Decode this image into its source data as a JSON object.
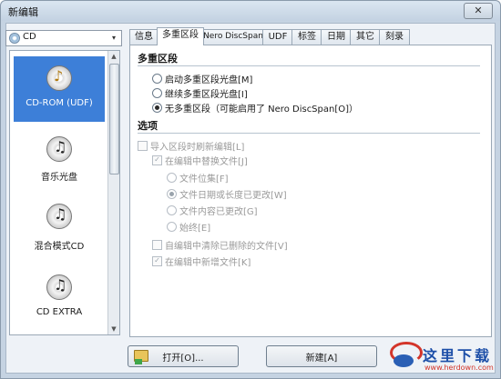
{
  "window": {
    "title": "新编辑",
    "close_glyph": "✕"
  },
  "disc_type_combo": {
    "value": "CD",
    "icon": "disc-icon",
    "arrow": "▾"
  },
  "sidebar": {
    "scroll_up": "▲",
    "scroll_down": "▼",
    "selected_arrow": "▸",
    "items": [
      {
        "label": "CD-ROM (UDF)",
        "icon": "cd-rom-icon",
        "glyph": "♪"
      },
      {
        "label": "音乐光盘",
        "icon": "music-disc-icon",
        "glyph": "♫"
      },
      {
        "label": "混合模式CD",
        "icon": "mixed-mode-cd-icon",
        "glyph": "♫"
      },
      {
        "label": "CD EXTRA",
        "icon": "cd-extra-icon",
        "glyph": "♫"
      }
    ]
  },
  "tabs": [
    {
      "label": "信息"
    },
    {
      "label": "多重区段"
    },
    {
      "label": "Nero DiscSpan"
    },
    {
      "label": "UDF"
    },
    {
      "label": "标签"
    },
    {
      "label": "日期"
    },
    {
      "label": "其它"
    },
    {
      "label": "刻录"
    }
  ],
  "active_tab": "多重区段",
  "multisession": {
    "heading": "多重区段",
    "options": [
      {
        "label": "启动多重区段光盘[M]",
        "selected": false
      },
      {
        "label": "继续多重区段光盘[I]",
        "selected": false
      },
      {
        "label": "无多重区段（可能启用了 Nero DiscSpan[O]）",
        "selected": true
      }
    ]
  },
  "options_section": {
    "heading": "选项",
    "import_refresh": "导入区段时刷新编辑[L]",
    "replace_in_edit": "在编辑中替换文件[J]",
    "replace_modes": [
      {
        "label": "文件位集[F]",
        "selected": false
      },
      {
        "label": "文件日期或长度已更改[W]",
        "selected": true
      },
      {
        "label": "文件内容已更改[G]",
        "selected": false
      },
      {
        "label": "始终[E]",
        "selected": false
      }
    ],
    "remove_deleted": "自编辑中清除已删除的文件[V]",
    "new_in_edit": "在编辑中新增文件[K]"
  },
  "buttons": {
    "open": "打开[O]...",
    "new": "新建[A]"
  },
  "watermark": {
    "text": "这里下载",
    "url": "www.herdown.com"
  }
}
